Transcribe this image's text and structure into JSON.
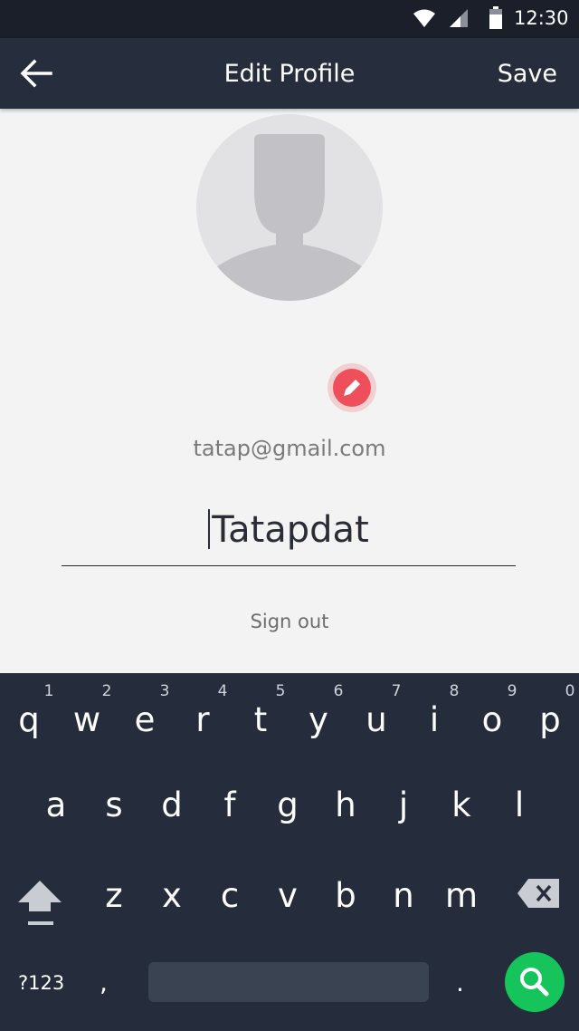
{
  "status_bar": {
    "time": "12:30",
    "icons": [
      "wifi-icon",
      "signal-icon",
      "battery-icon"
    ]
  },
  "app_bar": {
    "title": "Edit Profile",
    "save_label": "Save",
    "back_icon": "arrow-left-icon"
  },
  "profile": {
    "email": "tatap@gmail.com",
    "name_value": "Tatapdat",
    "sign_out_label": "Sign out",
    "edit_icon": "pencil-icon"
  },
  "keyboard": {
    "row1": [
      {
        "ch": "q",
        "hint": "1"
      },
      {
        "ch": "w",
        "hint": "2"
      },
      {
        "ch": "e",
        "hint": "3"
      },
      {
        "ch": "r",
        "hint": "4"
      },
      {
        "ch": "t",
        "hint": "5"
      },
      {
        "ch": "y",
        "hint": "6"
      },
      {
        "ch": "u",
        "hint": "7"
      },
      {
        "ch": "i",
        "hint": "8"
      },
      {
        "ch": "o",
        "hint": "9"
      },
      {
        "ch": "p",
        "hint": "0"
      }
    ],
    "row2": [
      "a",
      "s",
      "d",
      "f",
      "g",
      "h",
      "j",
      "k",
      "l"
    ],
    "row3": [
      "z",
      "x",
      "c",
      "v",
      "b",
      "n",
      "m"
    ],
    "sym_label": "?123",
    "comma": ",",
    "period": ".",
    "search_icon": "search-icon"
  },
  "colors": {
    "status_bar": "#1b1f29",
    "app_bar": "#262d3c",
    "background": "#f3f3f3",
    "keyboard": "#252c3b",
    "accent_edit": "#ef4f5a",
    "accent_search": "#15c55b"
  }
}
